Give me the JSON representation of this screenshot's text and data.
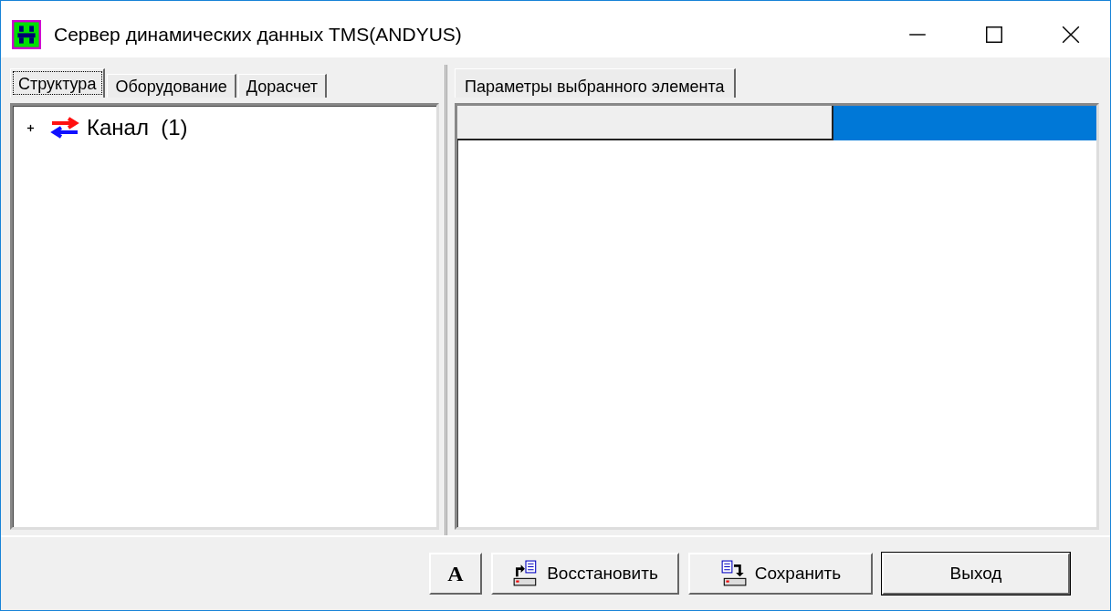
{
  "window": {
    "title": "Сервер динамических данных TMS(ANDYUS)"
  },
  "left_tabs": [
    {
      "label": "Структура",
      "selected": true
    },
    {
      "label": "Оборудование",
      "selected": false
    },
    {
      "label": "Дорасчет",
      "selected": false
    }
  ],
  "tree": [
    {
      "label": "Канал  (1)",
      "expanded": false
    }
  ],
  "right_tabs": [
    {
      "label": "Параметры выбранного элемента",
      "selected": true
    }
  ],
  "buttons": [
    {
      "kind": "font",
      "label": "A"
    },
    {
      "kind": "restore",
      "label": "Восстановить"
    },
    {
      "kind": "save",
      "label": "Сохранить"
    },
    {
      "kind": "plain",
      "label": "Выход"
    }
  ]
}
